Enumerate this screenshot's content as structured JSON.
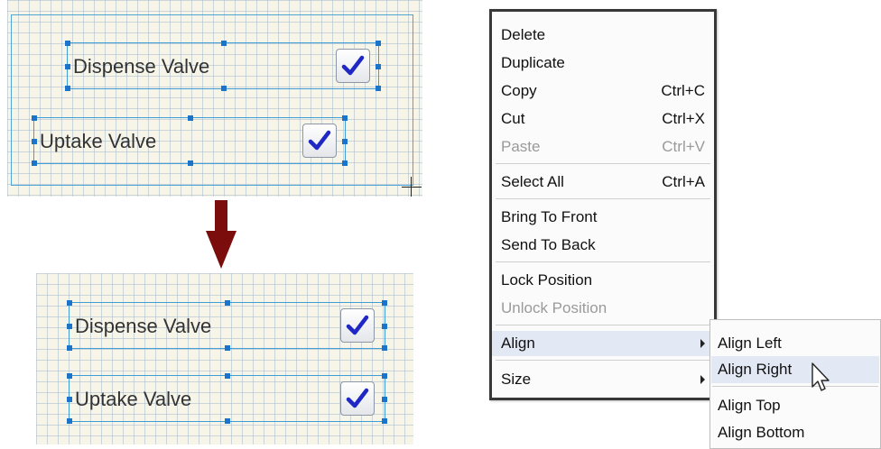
{
  "before": {
    "widgets": [
      {
        "label": "Dispense Valve",
        "checked": true
      },
      {
        "label": "Uptake Valve",
        "checked": true
      }
    ]
  },
  "after": {
    "widgets": [
      {
        "label": "Dispense Valve",
        "checked": true
      },
      {
        "label": "Uptake Valve",
        "checked": true
      }
    ]
  },
  "arrow_color": "#7b0d0d",
  "context_menu": {
    "items": [
      {
        "label": "Delete",
        "shortcut": "",
        "disabled": false
      },
      {
        "label": "Duplicate",
        "shortcut": "",
        "disabled": false
      },
      {
        "label": "Copy",
        "shortcut": "Ctrl+C",
        "disabled": false
      },
      {
        "label": "Cut",
        "shortcut": "Ctrl+X",
        "disabled": false
      },
      {
        "label": "Paste",
        "shortcut": "Ctrl+V",
        "disabled": true
      },
      {
        "label": "Select All",
        "shortcut": "Ctrl+A",
        "disabled": false
      },
      {
        "label": "Bring To Front",
        "shortcut": "",
        "disabled": false
      },
      {
        "label": "Send To Back",
        "shortcut": "",
        "disabled": false
      },
      {
        "label": "Lock Position",
        "shortcut": "",
        "disabled": false
      },
      {
        "label": "Unlock Position",
        "shortcut": "",
        "disabled": true
      },
      {
        "label": "Align",
        "shortcut": "",
        "disabled": false,
        "submenu": true,
        "highlighted": true
      },
      {
        "label": "Size",
        "shortcut": "",
        "disabled": false,
        "submenu": true
      }
    ]
  },
  "submenu": {
    "items": [
      {
        "label": "Align Left"
      },
      {
        "label": "Align Right",
        "highlighted": true
      },
      {
        "label": "Align Top"
      },
      {
        "label": "Align Bottom"
      }
    ]
  }
}
